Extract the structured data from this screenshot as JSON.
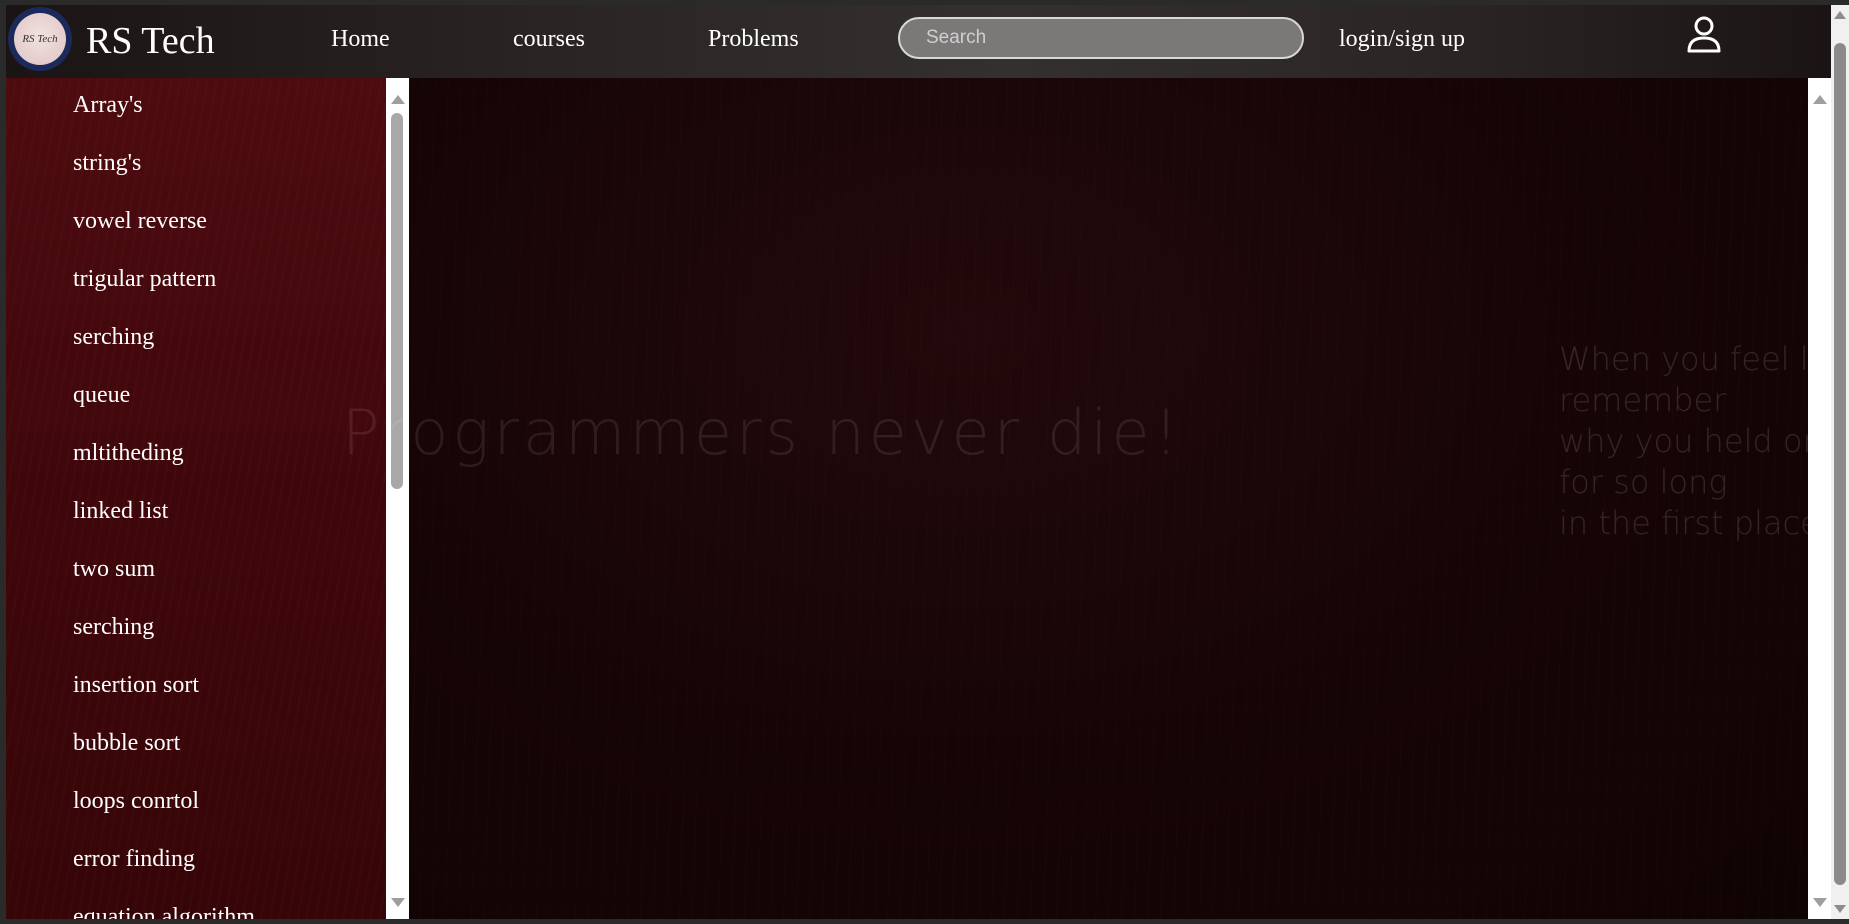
{
  "header": {
    "logo_text": "RS Tech",
    "brand": "RS Tech",
    "nav": [
      "Home",
      "courses",
      "Problems"
    ],
    "search_placeholder": "Search",
    "login": "login/sign up"
  },
  "sidebar": {
    "items": [
      "Array's",
      "string's",
      "vowel reverse",
      "trigular pattern",
      "serching",
      "queue",
      "mltitheding",
      "linked list",
      "two sum",
      "serching",
      "insertion sort",
      "bubble sort",
      "loops conrtol",
      "error finding",
      "equation algorithm"
    ]
  },
  "main": {
    "slogan": "Programmers never die!",
    "quote": [
      "When you feel like giving up,",
      "remember",
      "why you held on",
      "for so long",
      "in the first place."
    ]
  },
  "colors": {
    "sidebar_bg": "#4d0b0f",
    "main_bg": "#170506",
    "header_bg": "#2a2424"
  }
}
